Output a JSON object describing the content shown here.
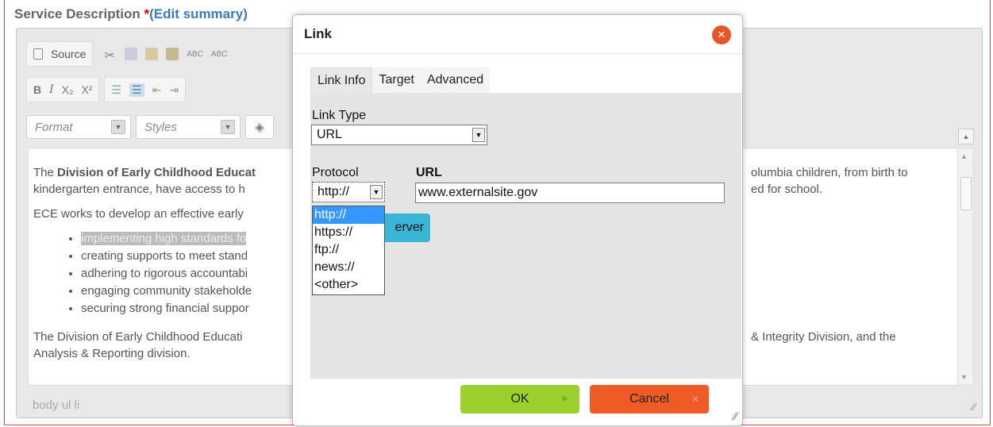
{
  "page": {
    "field_label": "Service Description",
    "required_mark": "*",
    "edit_summary": "(Edit summary)"
  },
  "toolbar": {
    "source_label": "Source",
    "bold": "B",
    "italic": "I",
    "subscript": "X₂",
    "superscript": "X²",
    "format_placeholder": "Format",
    "styles_placeholder": "Styles"
  },
  "content": {
    "para1_start": "The ",
    "para1_bold": "Division of Early Childhood Educat",
    "para1_mid": "olumbia children, from birth to",
    "para1_line2_left": "kindergarten entrance, have access to h",
    "para1_line2_right": "ed for school.",
    "para2": "ECE works to develop an effective early",
    "bullets": [
      "implementing high standards fo",
      "creating supports to meet stand",
      "adhering to rigorous accountabi",
      "engaging community stakeholde",
      "securing strong financial suppor"
    ],
    "para3_left": "The Division of Early Childhood Educati",
    "para3_right": "& Integrity Division, and the",
    "para3_line2": "Analysis & Reporting division."
  },
  "statusbar": {
    "path": "body  ul  li"
  },
  "dialog": {
    "title": "Link",
    "tabs": [
      "Link Info",
      "Target",
      "Advanced"
    ],
    "link_type_label": "Link Type",
    "link_type_value": "URL",
    "protocol_label": "Protocol",
    "protocol_value": "http://",
    "url_label": "URL",
    "url_value": "www.externalsite.gov",
    "browse_partial": "erver",
    "protocol_options": [
      "http://",
      "https://",
      "ftp://",
      "news://",
      "<other>"
    ],
    "ok_label": "OK",
    "cancel_label": "Cancel"
  },
  "colors": {
    "ok_green": "#9bd12c",
    "cancel_orange": "#ee5b24",
    "browse_blue": "#3bb5d6",
    "close_red": "#e8552a",
    "selection_blue": "#3399ff"
  }
}
